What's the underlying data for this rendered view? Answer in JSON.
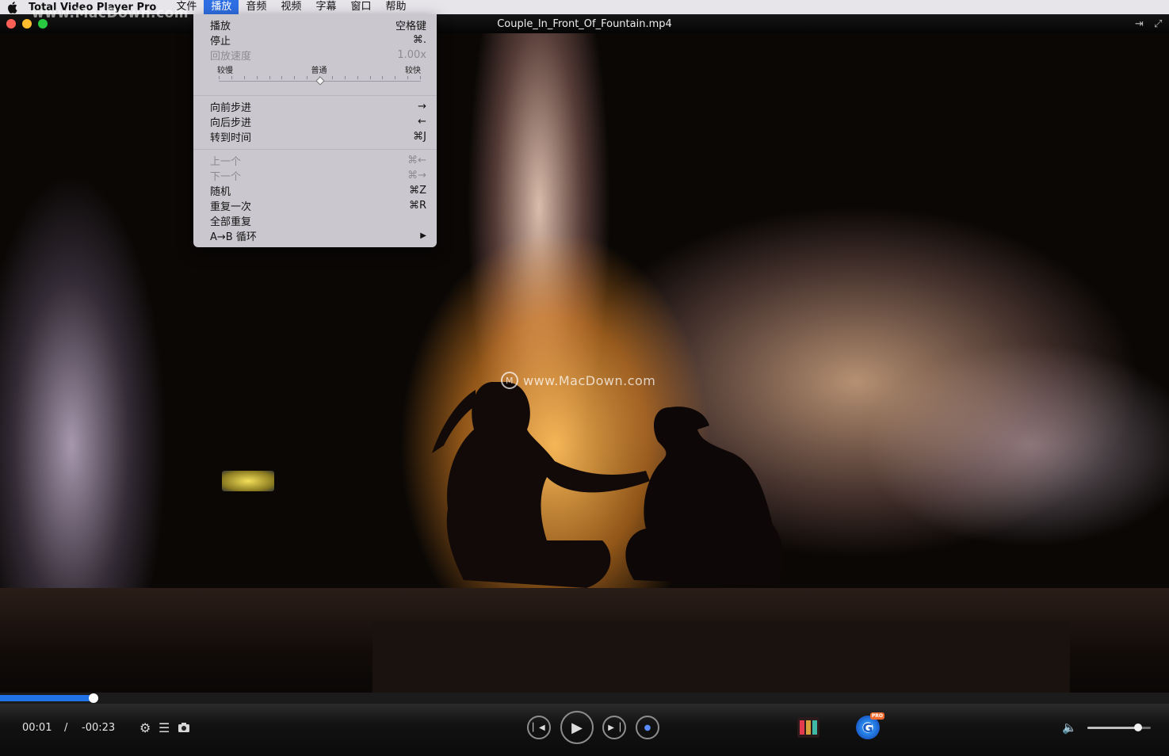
{
  "menubar": {
    "app_name": "Total Video Player Pro",
    "items": [
      "文件",
      "播放",
      "音频",
      "视频",
      "字幕",
      "窗口",
      "帮助"
    ],
    "active_item": "播放",
    "watermark": "www.MacDown.com"
  },
  "window": {
    "title": "Couple_In_Front_Of_Fountain.mp4"
  },
  "playback_menu": {
    "play": {
      "label": "播放",
      "shortcut": "空格键"
    },
    "stop": {
      "label": "停止",
      "shortcut": "⌘."
    },
    "speed": {
      "label": "回放速度",
      "value": "1.00x",
      "slow_label": "较慢",
      "normal_label": "普通",
      "fast_label": "较快",
      "level_fraction": 0.5
    },
    "step_forward": {
      "label": "向前步进",
      "shortcut": "→"
    },
    "step_back": {
      "label": "向后步进",
      "shortcut": "←"
    },
    "goto_time": {
      "label": "转到时间",
      "shortcut": "⌘J"
    },
    "previous": {
      "label": "上一个",
      "shortcut": "⌘←"
    },
    "next": {
      "label": "下一个",
      "shortcut": "⌘→"
    },
    "shuffle": {
      "label": "随机",
      "shortcut": "⌘Z"
    },
    "repeat_once": {
      "label": "重复一次",
      "shortcut": "⌘R"
    },
    "repeat_all": {
      "label": "全部重复"
    },
    "ab_loop": {
      "label": "A→B 循环",
      "shortcut": "▶"
    }
  },
  "video": {
    "watermark": "www.MacDown.com"
  },
  "controls": {
    "elapsed": "00:01",
    "separator": "/",
    "remaining": "-00:23",
    "progress_fraction": 0.08,
    "volume_fraction": 0.8
  },
  "colors": {
    "accent": "#1f73e6",
    "menu_highlight": "#2f6fe4"
  }
}
